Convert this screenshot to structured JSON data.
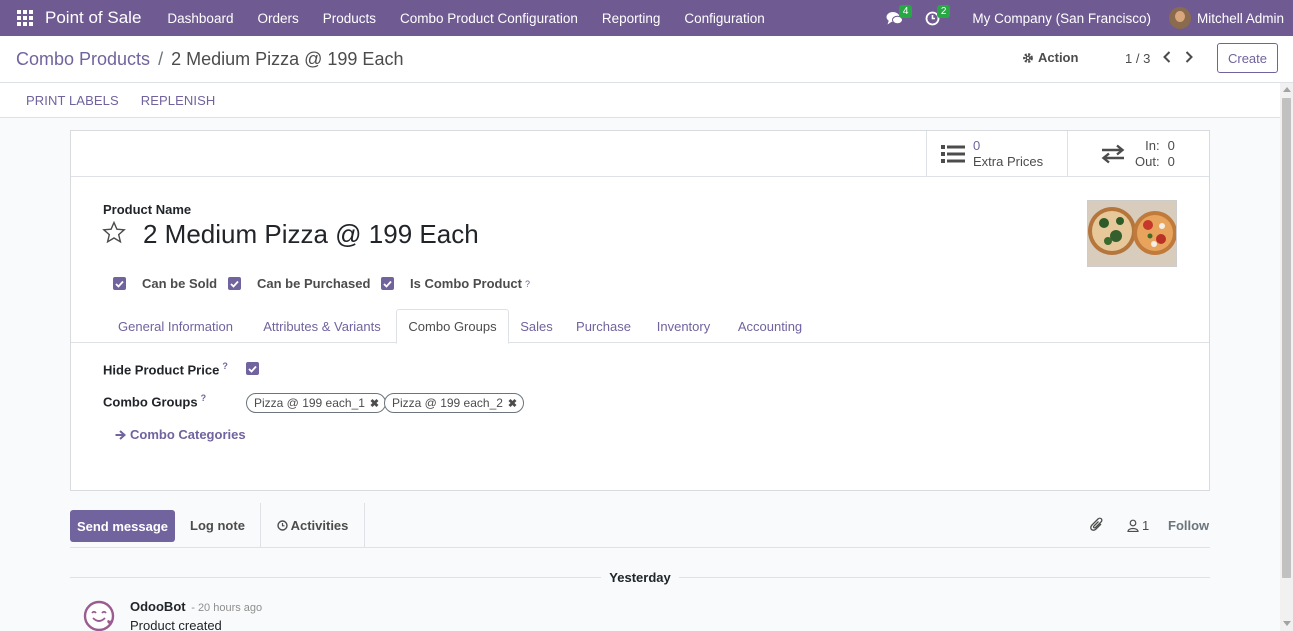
{
  "navbar": {
    "brand": "Point of Sale",
    "menu": [
      "Dashboard",
      "Orders",
      "Products",
      "Combo Product Configuration",
      "Reporting",
      "Configuration"
    ],
    "messages_badge": "4",
    "activities_badge": "2",
    "company": "My Company (San Francisco)",
    "user": "Mitchell Admin"
  },
  "control": {
    "breadcrumb_parent": "Combo Products",
    "breadcrumb_separator": "/",
    "breadcrumb_current": "2 Medium Pizza @ 199 Each",
    "action_label": "Action",
    "pager": "1 / 3",
    "create_label": "Create"
  },
  "statusbar": {
    "buttons": [
      "PRINT LABELS",
      "REPLENISH"
    ]
  },
  "smart_buttons": {
    "extra_prices_value": "0",
    "extra_prices_label": "Extra Prices",
    "in_label": "In:",
    "in_value": "0",
    "out_label": "Out:",
    "out_value": "0"
  },
  "form": {
    "product_name_label": "Product Name",
    "product_name": "2 Medium Pizza @ 199 Each",
    "checkboxes": [
      {
        "label": "Can be Sold",
        "checked": true
      },
      {
        "label": "Can be Purchased",
        "checked": true
      },
      {
        "label": "Is Combo Product",
        "checked": true,
        "help": "?"
      }
    ],
    "tabs": [
      "General Information",
      "Attributes & Variants",
      "Combo Groups",
      "Sales",
      "Purchase",
      "Inventory",
      "Accounting"
    ],
    "active_tab": "Combo Groups",
    "hide_price_label": "Hide Product Price",
    "hide_price_help": "?",
    "combo_groups_label": "Combo Groups",
    "combo_groups_help": "?",
    "combo_groups": [
      "Pizza @ 199 each_1",
      "Pizza @ 199 each_2"
    ],
    "combo_categories_link": "Combo Categories"
  },
  "chatter": {
    "send_message": "Send message",
    "log_note": "Log note",
    "activities": "Activities",
    "followers_count": "1",
    "follow": "Follow",
    "day_separator": "Yesterday",
    "message": {
      "author": "OdooBot",
      "time": "- 20 hours ago",
      "body": "Product created"
    }
  },
  "colors": {
    "navbar": "#6f5a92",
    "accent": "#71639e",
    "badge": "#28a745"
  }
}
